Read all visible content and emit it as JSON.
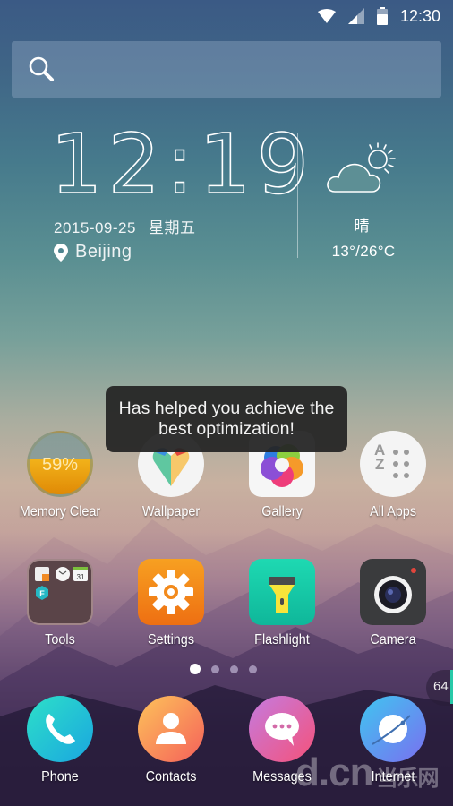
{
  "status_bar": {
    "time": "12:30",
    "icons": [
      "wifi-icon",
      "signal-icon",
      "battery-icon"
    ]
  },
  "search": {
    "icon": "search-icon",
    "placeholder": ""
  },
  "clock_widget": {
    "time": "12:19",
    "date": "2015-09-25",
    "weekday": "星期五",
    "location": "Beijing",
    "location_icon": "location-pin-icon"
  },
  "weather_widget": {
    "icon": "partly-cloudy-icon",
    "condition": "晴",
    "temperature": "13°/26°C"
  },
  "toast": {
    "line1": "Has helped you achieve the",
    "line2": "best optimization!"
  },
  "apps_row1": [
    {
      "label": "Memory Clear",
      "icon": "memory-clear-icon",
      "value": "59%"
    },
    {
      "label": "Wallpaper",
      "icon": "wallpaper-icon"
    },
    {
      "label": "Gallery",
      "icon": "gallery-icon"
    },
    {
      "label": "All Apps",
      "icon": "all-apps-icon"
    }
  ],
  "apps_row2": [
    {
      "label": "Tools",
      "icon": "tools-folder-icon",
      "calendar_day": "31"
    },
    {
      "label": "Settings",
      "icon": "settings-gear-icon"
    },
    {
      "label": "Flashlight",
      "icon": "flashlight-icon"
    },
    {
      "label": "Camera",
      "icon": "camera-icon"
    }
  ],
  "pager": {
    "pages": 4,
    "current": 1
  },
  "side_badge": {
    "value": "64"
  },
  "dock": [
    {
      "label": "Phone",
      "icon": "phone-icon"
    },
    {
      "label": "Contacts",
      "icon": "contacts-icon"
    },
    {
      "label": "Messages",
      "icon": "messages-icon"
    },
    {
      "label": "Internet",
      "icon": "internet-icon"
    }
  ],
  "watermark": {
    "main": "d.cn",
    "sub": "当乐网"
  }
}
